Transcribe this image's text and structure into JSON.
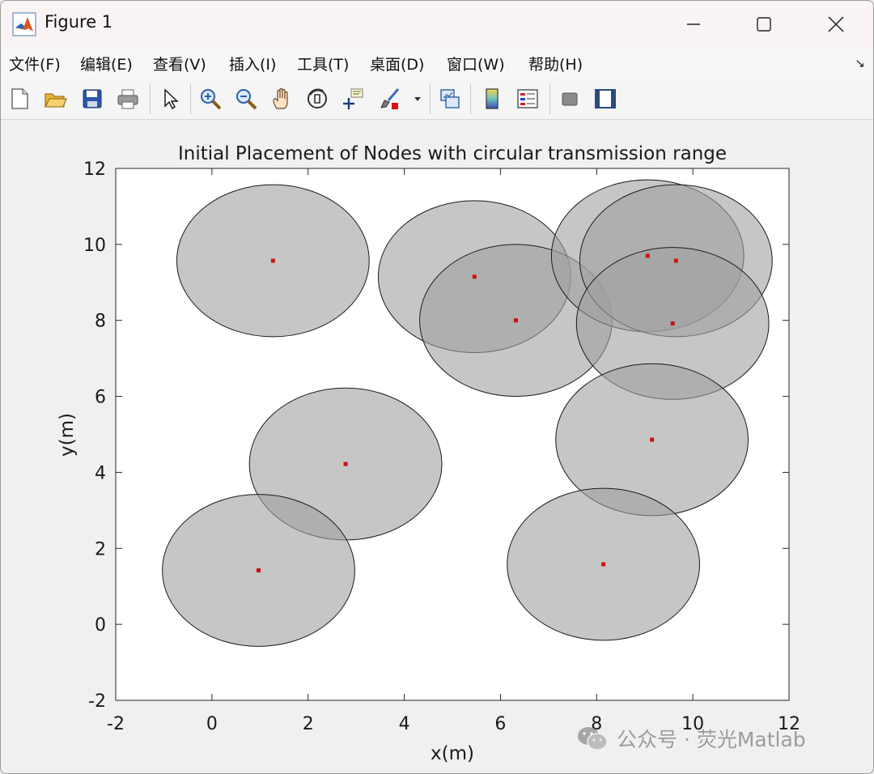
{
  "window": {
    "title": "Figure 1",
    "controls": {
      "minimize": "minimize-icon",
      "maximize": "maximize-icon",
      "close": "close-icon"
    }
  },
  "menu": {
    "items": [
      {
        "label": "文件(F)",
        "key": "F"
      },
      {
        "label": "编辑(E)",
        "key": "E"
      },
      {
        "label": "查看(V)",
        "key": "V"
      },
      {
        "label": "插入(I)",
        "key": "I"
      },
      {
        "label": "工具(T)",
        "key": "T"
      },
      {
        "label": "桌面(D)",
        "key": "D"
      },
      {
        "label": "窗口(W)",
        "key": "W"
      },
      {
        "label": "帮助(H)",
        "key": "H"
      }
    ],
    "dock_glyph": "↘"
  },
  "toolbar": {
    "buttons": [
      "new-figure-icon",
      "open-file-icon",
      "save-icon",
      "print-icon",
      "edit-plot-icon",
      "zoom-in-icon",
      "zoom-out-icon",
      "pan-icon",
      "rotate-3d-icon",
      "data-cursor-icon",
      "brush-icon",
      "link-plot-icon",
      "colorbar-icon",
      "legend-icon",
      "hide-plot-tools-icon",
      "show-plot-tools-icon"
    ]
  },
  "chart_data": {
    "type": "scatter",
    "title": "Initial Placement of Nodes with circular transmission range",
    "xlabel": "x(m)",
    "ylabel": "y(m)",
    "xlim": [
      -2,
      12
    ],
    "ylim": [
      -2,
      12
    ],
    "xticks": [
      -2,
      0,
      2,
      4,
      6,
      8,
      10,
      12
    ],
    "yticks": [
      -2,
      0,
      2,
      4,
      6,
      8,
      10,
      12
    ],
    "grid": false,
    "range_radius": 2,
    "range_fill": "#a0a0a0",
    "range_fill_opacity": 0.6,
    "range_edge": "#1a1a1a",
    "node_color": "#cc1111",
    "nodes": [
      {
        "x": 1.27,
        "y": 9.57
      },
      {
        "x": 5.46,
        "y": 9.15
      },
      {
        "x": 6.32,
        "y": 8.0
      },
      {
        "x": 9.06,
        "y": 9.7
      },
      {
        "x": 9.65,
        "y": 9.57
      },
      {
        "x": 9.58,
        "y": 7.92
      },
      {
        "x": 9.15,
        "y": 4.86
      },
      {
        "x": 2.78,
        "y": 4.22
      },
      {
        "x": 0.97,
        "y": 1.42
      },
      {
        "x": 8.14,
        "y": 1.58
      }
    ]
  },
  "watermark": {
    "text": "公众号 · 荧光Matlab",
    "icon": "wechat-icon"
  }
}
